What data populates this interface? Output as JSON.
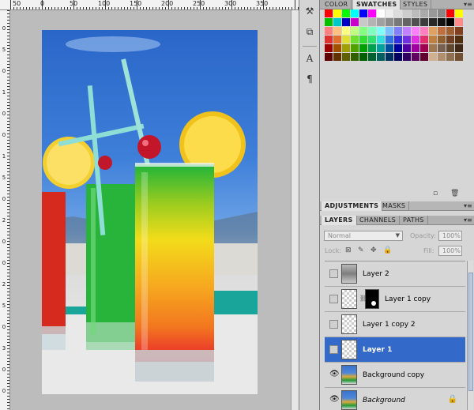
{
  "ruler": {
    "top_labels": [
      "50",
      "0",
      "50",
      "100",
      "150",
      "200",
      "250",
      "300",
      "350"
    ],
    "left_labels": [
      "0",
      "5",
      "0",
      "1",
      "0",
      "0",
      "1",
      "5",
      "0",
      "2",
      "0",
      "0",
      "2",
      "5",
      "0",
      "3",
      "0",
      "0"
    ]
  },
  "tools": {
    "icons": [
      "history-brush-icon",
      "tool-preset-icon",
      "character-icon",
      "paragraph-icon"
    ],
    "glyphs": [
      "⚒",
      "⧉",
      "A",
      "¶"
    ]
  },
  "panels": {
    "top_tabs": [
      "COLOR",
      "SWATCHES",
      "STYLES"
    ],
    "mid_tabs": [
      "ADJUSTMENTS",
      "MASKS"
    ],
    "layer_tabs": [
      "LAYERS",
      "CHANNELS",
      "PATHS"
    ],
    "swatches": [
      "#ff0000",
      "#ffff00",
      "#00ff00",
      "#00ffff",
      "#0000ff",
      "#ff00ff",
      "#ffffff",
      "#eeeeee",
      "#dddddd",
      "#cccccc",
      "#bbbbbb",
      "#aaaaaa",
      "#999999",
      "#888888",
      "#ff0000",
      "#ffff00",
      "#00c000",
      "#00c8c8",
      "#0000c8",
      "#c800c8",
      "#c8c8c8",
      "#b4b4b4",
      "#a0a0a0",
      "#8c8c8c",
      "#787878",
      "#646464",
      "#505050",
      "#3c3c3c",
      "#282828",
      "#141414",
      "#000000",
      "#ff8c8c",
      "#ff8080",
      "#ffc080",
      "#ffff80",
      "#c0ff80",
      "#80ff80",
      "#80ffc0",
      "#80ffff",
      "#80c0ff",
      "#8080ff",
      "#c080ff",
      "#ff80ff",
      "#ff80c0",
      "#e0a060",
      "#c07040",
      "#a06030",
      "#804020",
      "#e03030",
      "#e07030",
      "#e0e030",
      "#70e030",
      "#30e030",
      "#30e070",
      "#30e0e0",
      "#3070e0",
      "#3030e0",
      "#7030e0",
      "#e030e0",
      "#e03070",
      "#c08040",
      "#906030",
      "#704020",
      "#503010",
      "#a00000",
      "#a05000",
      "#a0a000",
      "#50a000",
      "#00a000",
      "#00a050",
      "#00a0a0",
      "#0050a0",
      "#0000a0",
      "#5000a0",
      "#a000a0",
      "#a00050",
      "#a07850",
      "#786050",
      "#604830",
      "#402818",
      "#600000",
      "#603000",
      "#606000",
      "#306000",
      "#006000",
      "#006030",
      "#006060",
      "#003060",
      "#000060",
      "#300060",
      "#600060",
      "#600030",
      "#d0b090",
      "#b09070",
      "#907050",
      "#705030"
    ],
    "blend_mode": "Normal",
    "opacity_label": "Opacity:",
    "opacity_value": "100%",
    "lock_label": "Lock:",
    "fill_label": "Fill:",
    "fill_value": "100%",
    "layers": [
      {
        "name": "Layer 2",
        "visible": false,
        "selected": false,
        "italic": false
      },
      {
        "name": "Layer 1 copy",
        "visible": false,
        "selected": false,
        "italic": false
      },
      {
        "name": "Layer 1 copy 2",
        "visible": false,
        "selected": false,
        "italic": false
      },
      {
        "name": "Layer 1",
        "visible": false,
        "selected": true,
        "italic": false
      },
      {
        "name": "Background copy",
        "visible": true,
        "selected": false,
        "italic": false
      },
      {
        "name": "Background",
        "visible": true,
        "selected": false,
        "italic": true
      }
    ]
  }
}
